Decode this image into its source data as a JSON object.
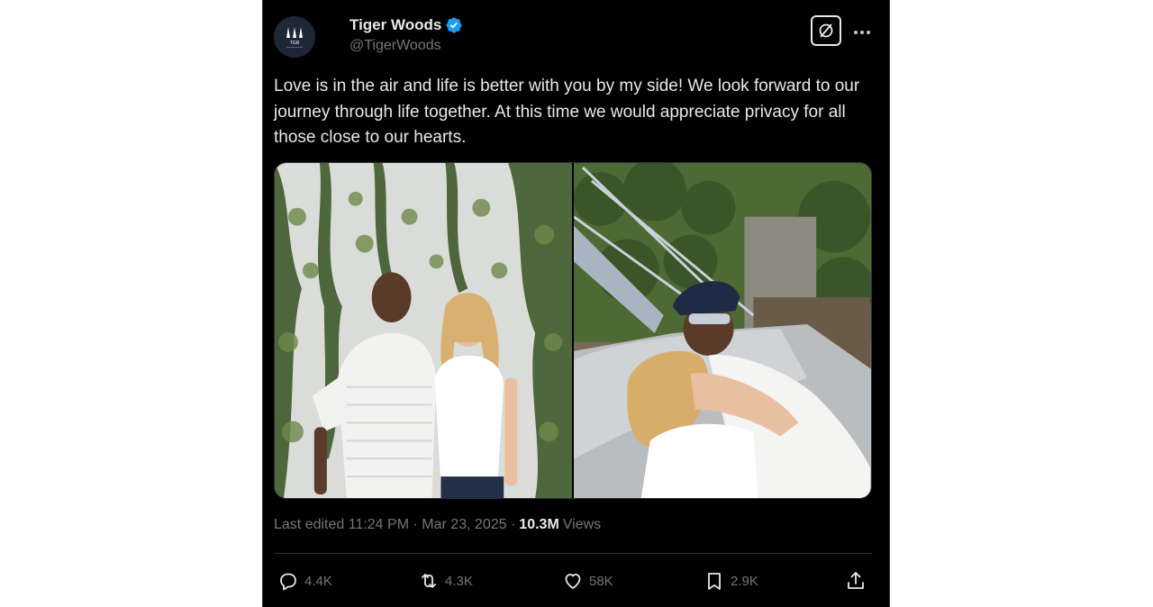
{
  "author": {
    "name": "Tiger Woods",
    "handle": "@TigerWoods",
    "verified": true,
    "avatar_text": "TGR"
  },
  "tweet": {
    "text": "Love is in the air and life is better with you by my side! We look forward to our journey through life together. At this time we would appreciate privacy for all those close to our hearts."
  },
  "meta": {
    "edited_label": "Last edited 11:24 PM · Mar 23, 2025 ·",
    "views_count": "10.3M",
    "views_label": "Views"
  },
  "actions": {
    "replies": "4.4K",
    "reposts": "4.3K",
    "likes": "58K",
    "bookmarks": "2.9K"
  },
  "colors": {
    "background": "#000000",
    "text_primary": "#e7e9ea",
    "text_secondary": "#71767b",
    "verified_blue": "#1d9bf0",
    "divider": "#2f3336"
  },
  "icons": [
    "verified-badge-icon",
    "grok-icon",
    "more-icon",
    "reply-icon",
    "repost-icon",
    "like-icon",
    "bookmark-icon",
    "share-icon"
  ]
}
